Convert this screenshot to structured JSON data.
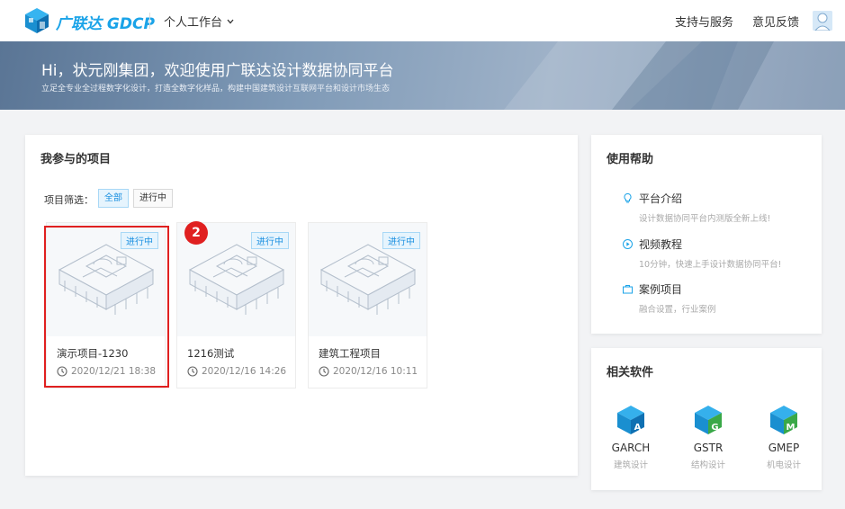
{
  "header": {
    "brand": "广联达 GDCP",
    "workbench": "个人工作台",
    "support": "支持与服务",
    "feedback": "意见反馈"
  },
  "banner": {
    "title": "Hi，状元刚集团，欢迎使用广联达设计数据协同平台",
    "subtitle": "立足全专业全过程数字化设计，打造全数字化样品，构建中国建筑设计互联网平台和设计市场生态"
  },
  "projects": {
    "title": "我参与的项目",
    "filter_label": "项目筛选：",
    "filters": [
      "全部",
      "进行中"
    ],
    "items": [
      {
        "name": "演示项目-1230",
        "date": "2020/12/21 18:38",
        "status": "进行中"
      },
      {
        "name": "1216测试",
        "date": "2020/12/16 14:26",
        "status": "进行中"
      },
      {
        "name": "建筑工程项目",
        "date": "2020/12/16 10:11",
        "status": "进行中"
      }
    ],
    "step_badge": "2"
  },
  "help": {
    "title": "使用帮助",
    "items": [
      {
        "label": "平台介绍",
        "desc": "设计数据协同平台内测版全新上线!"
      },
      {
        "label": "视频教程",
        "desc": "10分钟，快速上手设计数据协同平台!"
      },
      {
        "label": "案例项目",
        "desc": "融合设置，行业案例"
      }
    ]
  },
  "software": {
    "title": "相关软件",
    "items": [
      {
        "name": "GARCH",
        "desc": "建筑设计",
        "letter": "A"
      },
      {
        "name": "GSTR",
        "desc": "结构设计",
        "letter": "G"
      },
      {
        "name": "GMEP",
        "desc": "机电设计",
        "letter": "M"
      }
    ]
  },
  "colors": {
    "accent": "#1aa3e8",
    "highlight": "#e02020",
    "tag_bg": "#e6f4fd"
  }
}
